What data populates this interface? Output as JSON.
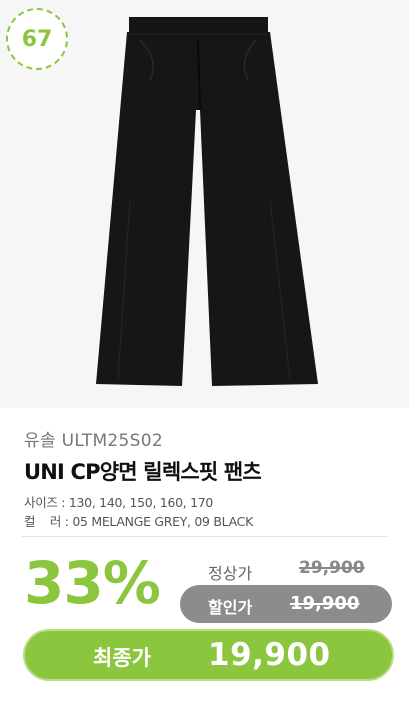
{
  "badge": {
    "number": "67"
  },
  "product": {
    "brand_code": "유솔 ULTM25S02",
    "title": "UNI CP양면 릴렉스핏 팬츠",
    "size_label": "사이즈 :",
    "size_value": "130, 140, 150, 160, 170",
    "color_label": "컬    러 :",
    "color_value": "05 MELANGE GREY, 09 BLACK"
  },
  "pricing": {
    "discount_rate": "33%",
    "regular_label": "정상가",
    "regular_price": "29,900",
    "sale_label": "할인가",
    "sale_price": "19,900",
    "final_label": "최종가",
    "final_price": "19,900"
  },
  "colors": {
    "accent": "#8cc63f",
    "sale_pill": "#8c8c8c",
    "photo_bg": "#f6f6f6"
  }
}
